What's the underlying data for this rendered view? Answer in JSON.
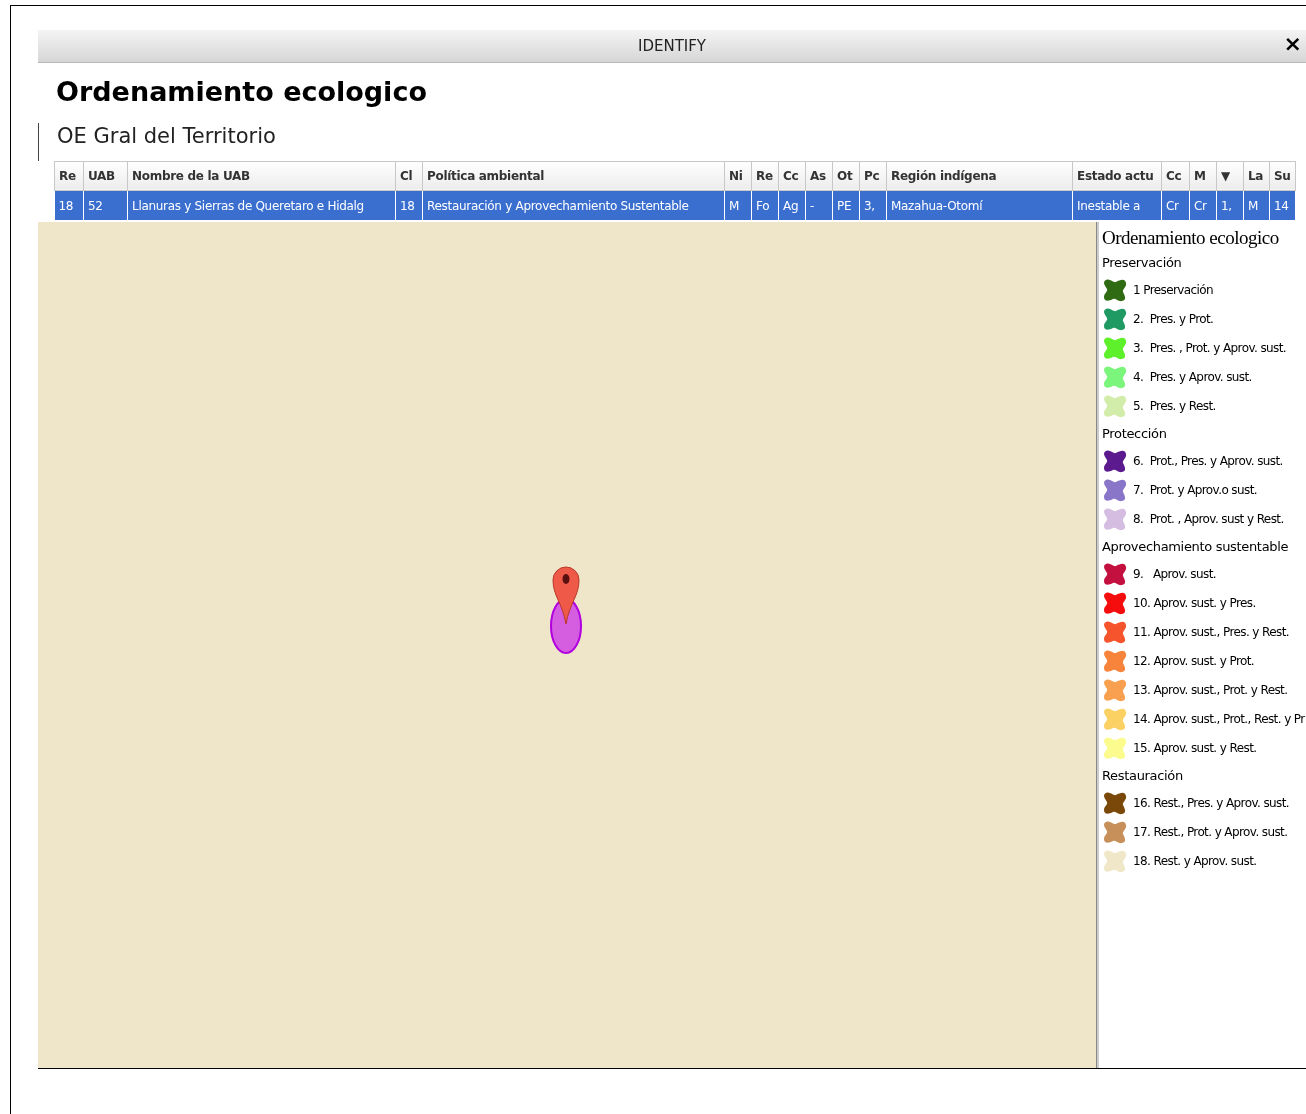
{
  "window": {
    "title": "IDENTIFY",
    "close": "×"
  },
  "heading": "Ordenamiento ecologico",
  "subtitle": "OE Gral del Territorio",
  "table": {
    "columns": [
      "Re",
      "UAB",
      "Nombre de la UAB",
      "Cl",
      "Política ambiental",
      "Ni",
      "Re",
      "Cc",
      "As",
      "Ot",
      "Pc",
      "Región indígena",
      "Estado actu",
      "Cc",
      "M",
      "▼",
      "La",
      "Su"
    ],
    "rows": [
      {
        "selected": true,
        "cells": [
          "18",
          "52",
          "Llanuras y Sierras de Queretaro e Hidalg",
          "18",
          "Restauración y Aprovechamiento Sustentable",
          "M",
          "Fo",
          "Ag",
          "-",
          "PE",
          "3,",
          "Mazahua-Otomí",
          "Inestable a",
          "Cr",
          "Cr",
          "1,",
          "M",
          "14"
        ]
      }
    ]
  },
  "legend": {
    "title": "Ordenamiento ecologico",
    "groups": [
      {
        "name": "Preservación",
        "items": [
          {
            "label": "1 Preservación",
            "color": "#2e6b12"
          },
          {
            "label": "2.  Pres. y Prot.",
            "color": "#1f9a63"
          },
          {
            "label": "3.  Pres. , Prot. y Aprov. sust.",
            "color": "#5ef02a"
          },
          {
            "label": "4.  Pres. y Aprov. sust.",
            "color": "#7cf57c"
          },
          {
            "label": "5.  Pres. y Rest.",
            "color": "#d2ecaa"
          }
        ]
      },
      {
        "name": "Protección",
        "items": [
          {
            "label": "6.  Prot., Pres. y Aprov. sust.",
            "color": "#5b1a8e"
          },
          {
            "label": "7.  Prot. y Aprov.o sust.",
            "color": "#8a76c9"
          },
          {
            "label": "8.  Prot. , Aprov. sust y Rest.",
            "color": "#d4bde0"
          }
        ]
      },
      {
        "name": "Aprovechamiento sustentable",
        "items": [
          {
            "label": "9.   Aprov. sust.",
            "color": "#c4103f"
          },
          {
            "label": "10. Aprov. sust. y Pres.",
            "color": "#f50d0d"
          },
          {
            "label": "11. Aprov. sust., Pres. y Rest.",
            "color": "#f5542c"
          },
          {
            "label": "12. Aprov. sust. y Prot.",
            "color": "#f7843a"
          },
          {
            "label": "13. Aprov. sust., Prot. y Rest.",
            "color": "#f9a050"
          },
          {
            "label": "14. Aprov. sust., Prot., Rest. y Pr",
            "color": "#fbd163"
          },
          {
            "label": "15. Aprov. sust. y Rest.",
            "color": "#fbfb8e"
          }
        ]
      },
      {
        "name": "Restauración",
        "items": [
          {
            "label": "16. Rest., Pres. y Aprov. sust.",
            "color": "#7a4808"
          },
          {
            "label": "17. Rest., Prot. y Aprov. sust.",
            "color": "#c7905a"
          },
          {
            "label": "18. Rest. y Aprov. sust.",
            "color": "#efe7c8"
          }
        ]
      }
    ]
  }
}
